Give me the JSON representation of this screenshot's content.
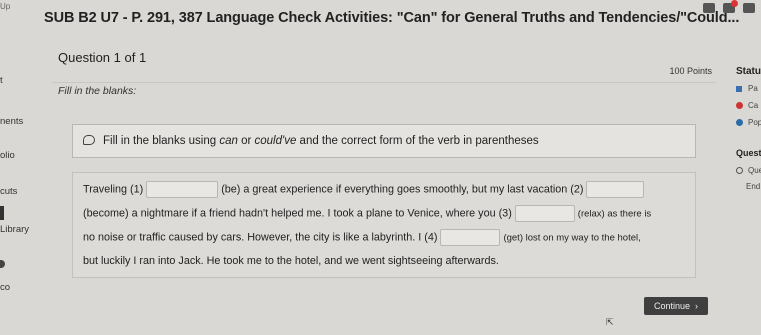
{
  "corner_label": "Up",
  "title": "SUB B2 U7 - P. 291, 387 Language Check Activities: \"Can\" for General Truths and Tendencies/\"Could...",
  "left_nav": [
    {
      "label": "t"
    },
    {
      "label": "nents"
    },
    {
      "label": "olio"
    },
    {
      "label": "cuts"
    },
    {
      "label": "Library"
    },
    {
      "label": "co"
    }
  ],
  "question": {
    "header": "Question 1 of 1",
    "points": "100 Points",
    "instruction_short": "Fill in the blanks:",
    "instruction_prefix": "Fill in the blanks using ",
    "instruction_can": "can",
    "instruction_or": " or ",
    "instruction_could": "could've",
    "instruction_suffix": " and the correct form of the verb in parentheses"
  },
  "passage": {
    "l1_a": "Traveling (1)",
    "l1_b": "(be) a great experience if everything goes smoothly, but my last vacation (2)",
    "l2_a": "(become) a nightmare if a friend hadn't helped me. I took a plane to Venice, where you (3)",
    "l2_b": "(relax) as there is",
    "l3_a": "no noise or traffic caused by cars. However, the city is like a labyrinth. I (4)",
    "l3_b": "(get) lost on my way to the hotel,",
    "l4": "but luckily I ran into Jack. He took me to the hotel, and we went sightseeing afterwards."
  },
  "continue_label": "Continue",
  "status_panel": {
    "title": "Status",
    "rows": [
      "Pa",
      "Ca",
      "Pop"
    ],
    "questions_title": "Questi",
    "q_rows": [
      "Que",
      "End"
    ]
  }
}
